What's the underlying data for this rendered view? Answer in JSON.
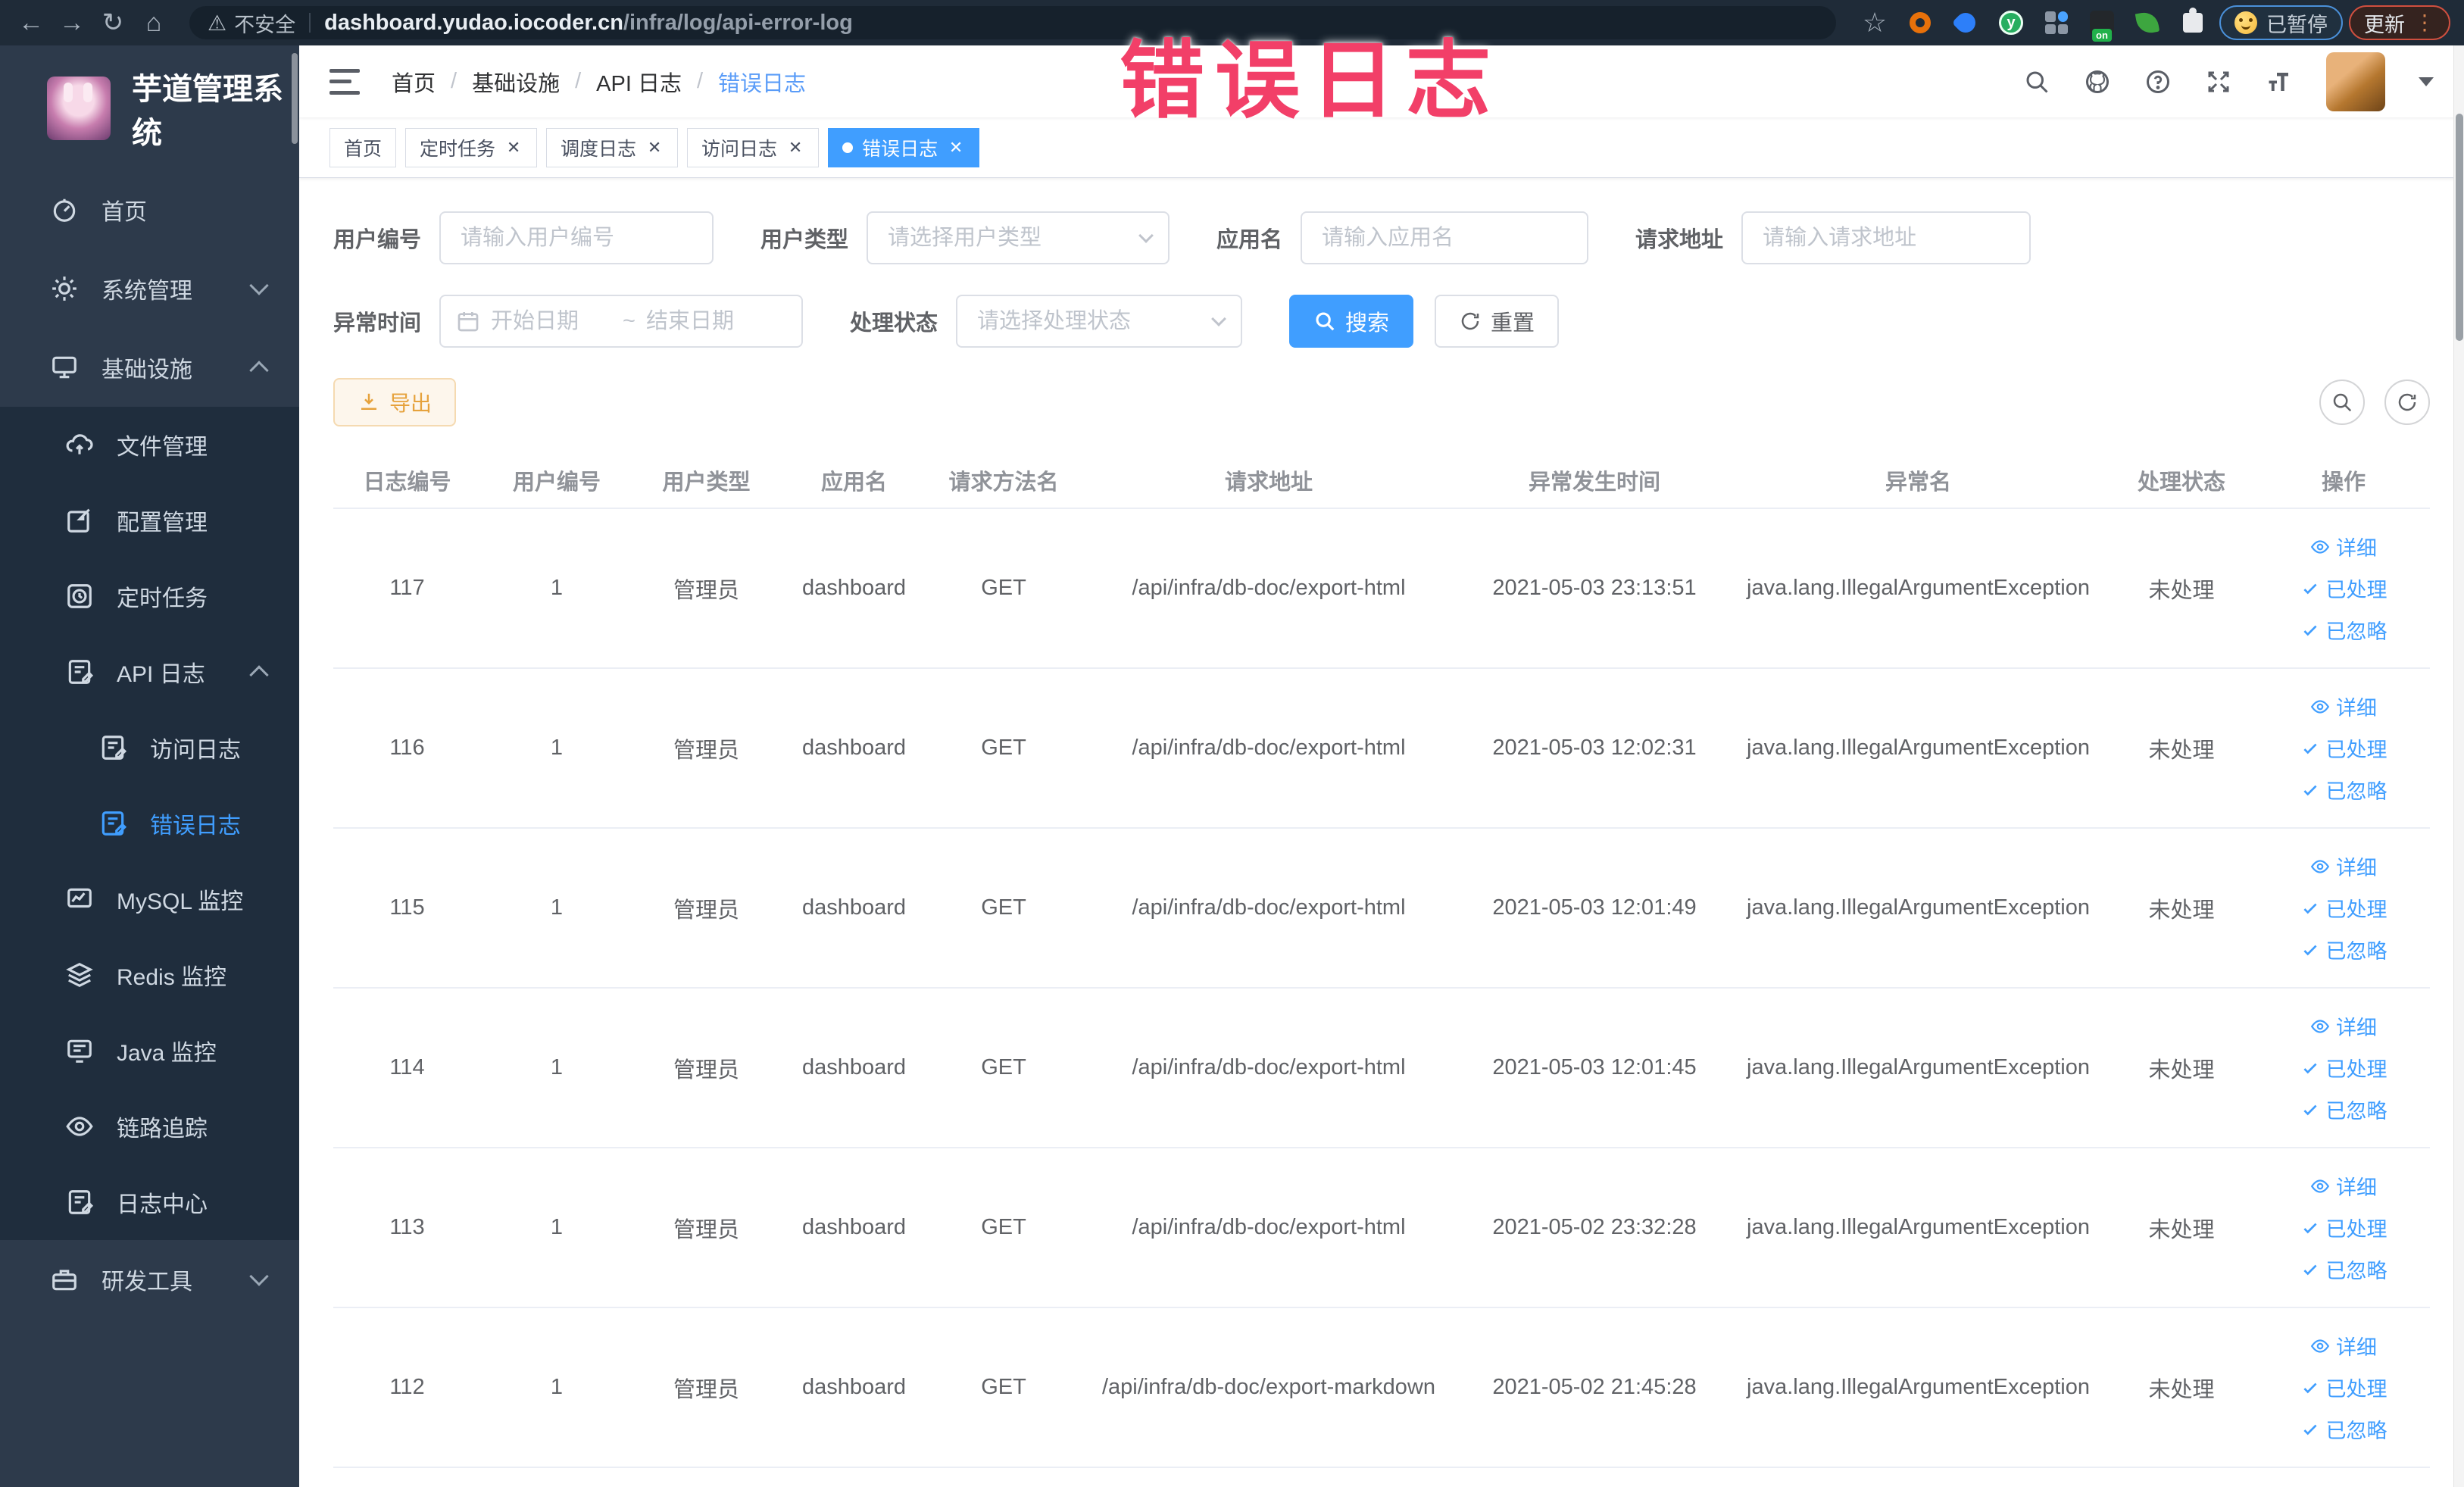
{
  "annotation": {
    "text": "错误日志",
    "color": "#f23f68"
  },
  "browser": {
    "security_label": "不安全",
    "url_domain": "dashboard.yudao.iocoder.cn",
    "url_path": "/infra/log/api-error-log",
    "paused_label": "已暂停",
    "update_label": "更新"
  },
  "sidebar": {
    "title": "芋道管理系统",
    "items": [
      {
        "label": "首页"
      },
      {
        "label": "系统管理"
      },
      {
        "label": "基础设施"
      },
      {
        "label": "文件管理"
      },
      {
        "label": "配置管理"
      },
      {
        "label": "定时任务"
      },
      {
        "label": "API 日志"
      },
      {
        "label": "访问日志"
      },
      {
        "label": "错误日志"
      },
      {
        "label": "MySQL 监控"
      },
      {
        "label": "Redis 监控"
      },
      {
        "label": "Java 监控"
      },
      {
        "label": "链路追踪"
      },
      {
        "label": "日志中心"
      },
      {
        "label": "研发工具"
      }
    ]
  },
  "navbar": {
    "breadcrumb": [
      "首页",
      "基础设施",
      "API 日志",
      "错误日志"
    ]
  },
  "tabs": {
    "items": [
      {
        "label": "首页"
      },
      {
        "label": "定时任务"
      },
      {
        "label": "调度日志"
      },
      {
        "label": "访问日志"
      },
      {
        "label": "错误日志"
      }
    ]
  },
  "filters": {
    "user_id_label": "用户编号",
    "user_id_placeholder": "请输入用户编号",
    "user_type_label": "用户类型",
    "user_type_placeholder": "请选择用户类型",
    "app_name_label": "应用名",
    "app_name_placeholder": "请输入应用名",
    "request_url_label": "请求地址",
    "request_url_placeholder": "请输入请求地址",
    "exception_time_label": "异常时间",
    "start_date_placeholder": "开始日期",
    "date_separator": "~",
    "end_date_placeholder": "结束日期",
    "process_status_label": "处理状态",
    "process_status_placeholder": "请选择处理状态",
    "search_label": "搜索",
    "reset_label": "重置"
  },
  "toolbar": {
    "export_label": "导出"
  },
  "table": {
    "headers": [
      "日志编号",
      "用户编号",
      "用户类型",
      "应用名",
      "请求方法名",
      "请求地址",
      "异常发生时间",
      "异常名",
      "处理状态",
      "操作"
    ],
    "actions": {
      "detail": "详细",
      "processed": "已处理",
      "ignored": "已忽略"
    },
    "rows": [
      {
        "id": "117",
        "user_id": "1",
        "user_type": "管理员",
        "app": "dashboard",
        "method": "GET",
        "url": "/api/infra/db-doc/export-html",
        "time": "2021-05-03 23:13:51",
        "exception": "java.lang.IllegalArgumentException",
        "status": "未处理"
      },
      {
        "id": "116",
        "user_id": "1",
        "user_type": "管理员",
        "app": "dashboard",
        "method": "GET",
        "url": "/api/infra/db-doc/export-html",
        "time": "2021-05-03 12:02:31",
        "exception": "java.lang.IllegalArgumentException",
        "status": "未处理"
      },
      {
        "id": "115",
        "user_id": "1",
        "user_type": "管理员",
        "app": "dashboard",
        "method": "GET",
        "url": "/api/infra/db-doc/export-html",
        "time": "2021-05-03 12:01:49",
        "exception": "java.lang.IllegalArgumentException",
        "status": "未处理"
      },
      {
        "id": "114",
        "user_id": "1",
        "user_type": "管理员",
        "app": "dashboard",
        "method": "GET",
        "url": "/api/infra/db-doc/export-html",
        "time": "2021-05-03 12:01:45",
        "exception": "java.lang.IllegalArgumentException",
        "status": "未处理"
      },
      {
        "id": "113",
        "user_id": "1",
        "user_type": "管理员",
        "app": "dashboard",
        "method": "GET",
        "url": "/api/infra/db-doc/export-html",
        "time": "2021-05-02 23:32:28",
        "exception": "java.lang.IllegalArgumentException",
        "status": "未处理"
      },
      {
        "id": "112",
        "user_id": "1",
        "user_type": "管理员",
        "app": "dashboard",
        "method": "GET",
        "url": "/api/infra/db-doc/export-markdown",
        "time": "2021-05-02 21:45:28",
        "exception": "java.lang.IllegalArgumentException",
        "status": "未处理"
      }
    ]
  },
  "colors": {
    "accent": "#409eff",
    "warning": "#e6a23c",
    "sidebar_bg": "#2d3a4b",
    "submenu_bg": "#1f2d3d"
  }
}
